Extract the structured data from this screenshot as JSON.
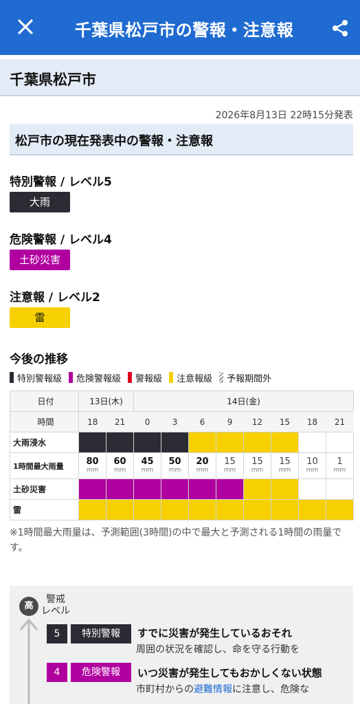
{
  "topbar": {
    "title": "千葉県松戸市の警報・注意報",
    "close_icon": "close-icon",
    "share_icon": "share-icon",
    "color": "#1f6bd1"
  },
  "city": {
    "name": "千葉県松戸市"
  },
  "issued": "2026年8月13日 22時15分発表",
  "section_title": "松戸市の現在発表中の警報・注意報",
  "levels": [
    {
      "title": "特別警報 / レベル5",
      "chip": "大雨",
      "color": "#2b2b33"
    },
    {
      "title": "危険警報 / レベル4",
      "chip": "土砂災害",
      "color": "#b0009f"
    },
    {
      "title": "注意報 / レベル2",
      "chip": "雷",
      "color": "#f6d000"
    }
  ],
  "forecast": {
    "title": "今後の推移",
    "legend": [
      "特別警報級",
      "危険警報級",
      "警報級",
      "注意報級",
      "予報期間外"
    ],
    "date_label": "日付",
    "dates": [
      "13日(木)",
      "14日(金)"
    ],
    "time_label": "時間",
    "times": [
      "18",
      "21",
      "0",
      "3",
      "6",
      "9",
      "12",
      "15",
      "18",
      "21"
    ],
    "rows": {
      "flood": {
        "label": "大雨浸水",
        "levels": [
          "special",
          "special",
          "special",
          "special",
          "advisory",
          "advisory",
          "advisory",
          "advisory",
          "none",
          "none"
        ]
      },
      "rain": {
        "label": "1時間最大雨量",
        "values": [
          "80",
          "60",
          "45",
          "50",
          "20",
          "15",
          "15",
          "15",
          "10",
          "1"
        ],
        "unit": "mm"
      },
      "landslide": {
        "label": "土砂災害",
        "levels": [
          "danger",
          "danger",
          "danger",
          "danger",
          "danger",
          "danger",
          "advisory",
          "advisory",
          "none",
          "none"
        ]
      },
      "thunder": {
        "label": "雷",
        "levels": [
          "advisory",
          "advisory",
          "advisory",
          "advisory",
          "advisory",
          "advisory",
          "advisory",
          "advisory",
          "advisory",
          "advisory"
        ]
      }
    }
  },
  "note": "※1時間最大雨量は、予測範囲(3時間)の中で最大と予測される1時間の雨量です。",
  "level_panel": {
    "high": "高",
    "caption": "警戒\nレベル",
    "items": [
      {
        "num": "5",
        "name": "特別警報",
        "head": "すでに災害が発生しているおそれ",
        "desc": "周囲の状況を確認し、命を守る行動を"
      },
      {
        "num": "4",
        "name": "危険警報",
        "head": "いつ災害が発生してもおかしくない状態",
        "desc_pre": "市町村からの",
        "desc_link": "避難情報",
        "desc_post": "に注意し、危険な"
      }
    ]
  }
}
